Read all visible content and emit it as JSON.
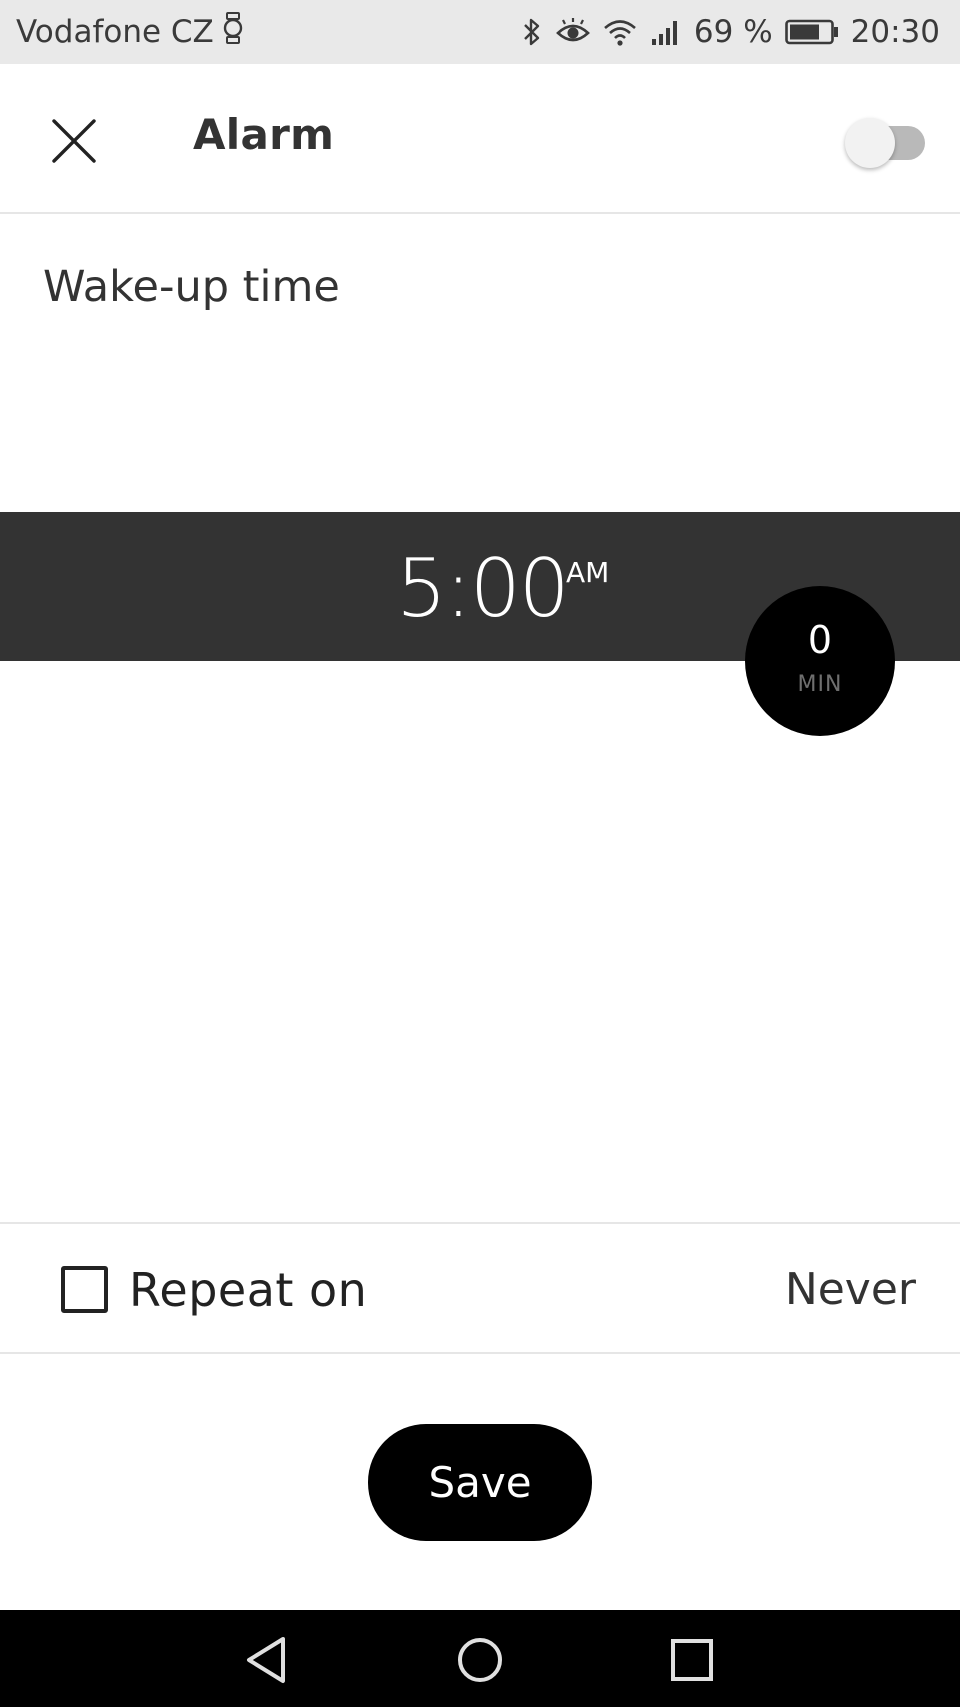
{
  "status_bar": {
    "carrier": "Vodafone CZ",
    "battery_percent": "69 %",
    "time": "20:30",
    "icons": [
      "watch-icon",
      "bluetooth-icon",
      "eye-comfort-icon",
      "wifi-icon",
      "signal-icon",
      "battery-icon"
    ]
  },
  "header": {
    "title": "Alarm",
    "close_icon": "close-icon",
    "toggle_state": "off"
  },
  "wake_up": {
    "label": "Wake-up time",
    "time": "5:00",
    "period": "AM"
  },
  "snooze": {
    "value": "0",
    "unit": "MIN"
  },
  "repeat": {
    "label": "Repeat on",
    "value": "Never",
    "checked": false
  },
  "actions": {
    "save_label": "Save"
  },
  "nav_bar": {
    "icons": [
      "back-icon",
      "home-icon",
      "recents-icon"
    ]
  },
  "colors": {
    "time_band": "#333333",
    "status_bar": "#e9e9e9",
    "button_bg": "#000000",
    "toggle_track": "#b9b9b9"
  }
}
